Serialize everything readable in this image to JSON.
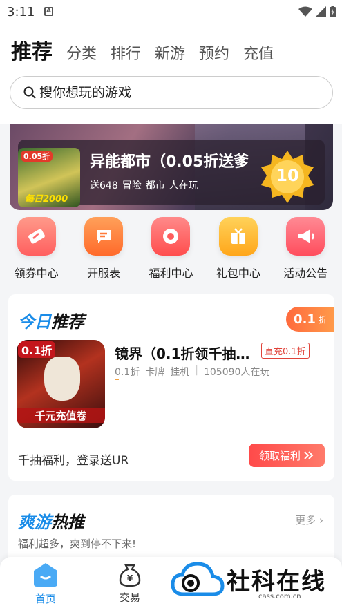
{
  "status_bar": {
    "time": "3:11",
    "notification": "A"
  },
  "tabs": [
    {
      "label": "推荐",
      "active": true
    },
    {
      "label": "分类"
    },
    {
      "label": "排行"
    },
    {
      "label": "新游"
    },
    {
      "label": "预约"
    },
    {
      "label": "充值"
    }
  ],
  "search": {
    "placeholder": "搜你想玩的游戏"
  },
  "banner": {
    "title": "异能都市（0.05折送爹",
    "thumb_discount": "0.05折",
    "thumb_caption": "每日2000",
    "meta": [
      "送648",
      "冒险",
      "都市",
      "人在玩"
    ],
    "medal_number": "10"
  },
  "quick_menu": [
    {
      "label": "领券中心",
      "icon": "ticket-icon",
      "color": "#ff6b6b"
    },
    {
      "label": "开服表",
      "icon": "server-list-icon",
      "color": "#ff7a3a"
    },
    {
      "label": "福利中心",
      "icon": "welfare-icon",
      "color": "#ff5c5c"
    },
    {
      "label": "礼包中心",
      "icon": "gift-icon",
      "color": "#ffb320"
    },
    {
      "label": "活动公告",
      "icon": "megaphone-icon",
      "color": "#ff5f6d"
    }
  ],
  "today_recommend": {
    "title_part1": "今日",
    "title_part2": "推荐",
    "discount_value": "0.1",
    "discount_unit": "折",
    "image_discount": "0.1折",
    "image_caption": "千元充值卷",
    "game_name": "镜界（0.1折领千抽…",
    "tag": "直充0.1折",
    "meta": [
      "0.1折",
      "卡牌",
      "挂机",
      "105090人在玩"
    ],
    "promo_text": "千抽福利，登录送UR",
    "claim_button": "领取福利"
  },
  "hot_games": {
    "title_part1": "爽游",
    "title_part2": "热推",
    "more": "更多",
    "subtitle": "福利超多，爽到停不下来!"
  },
  "bottom_nav": [
    {
      "label": "首页",
      "active": true
    },
    {
      "label": "交易"
    }
  ],
  "watermark": {
    "text": "社科在线",
    "url": "cass.com.cn"
  },
  "colors": {
    "accent": "#1a8ce8",
    "red": "#e0433a",
    "orange": "#ff6a3d"
  }
}
